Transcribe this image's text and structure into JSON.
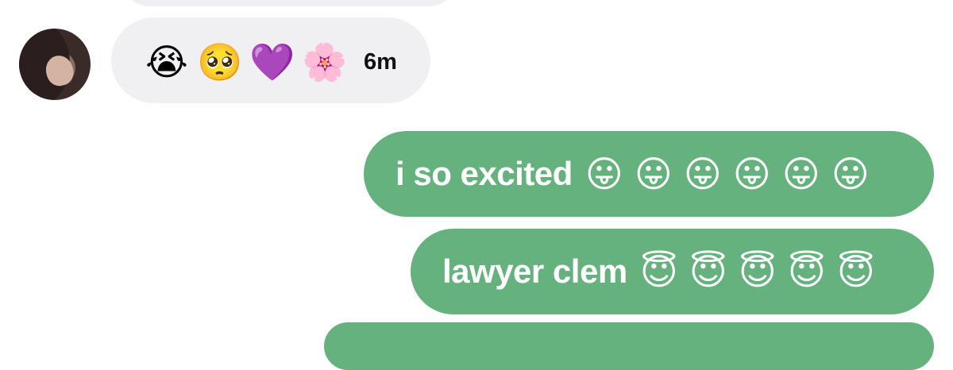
{
  "incoming": {
    "reactions": [
      "😭",
      "🥺",
      "💜",
      "🌸"
    ],
    "timestamp": "6m"
  },
  "outgoing": [
    {
      "text": "i so excited",
      "emojis": [
        "😛",
        "😛",
        "😛",
        "😛",
        "😛",
        "😛"
      ]
    },
    {
      "text": "lawyer clem",
      "emojis": [
        "😇",
        "😇",
        "😇",
        "😇",
        "😇"
      ]
    }
  ]
}
